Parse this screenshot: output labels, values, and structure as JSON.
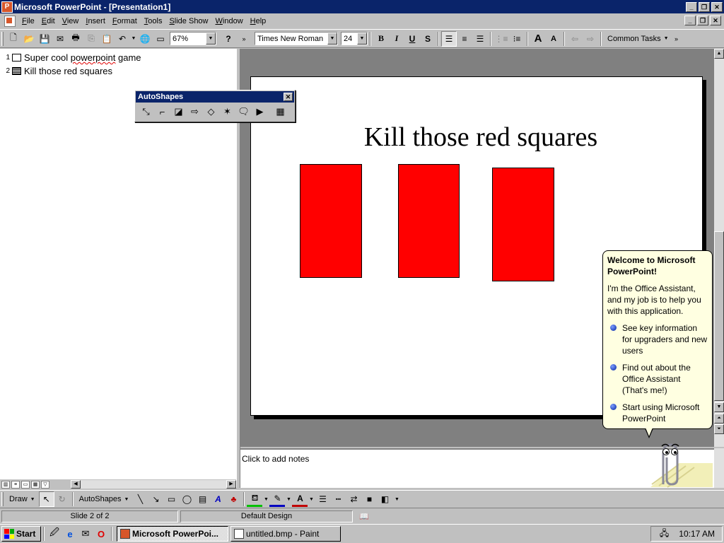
{
  "window": {
    "title": "Microsoft PowerPoint - [Presentation1]"
  },
  "menu": {
    "items": [
      "File",
      "Edit",
      "View",
      "Insert",
      "Format",
      "Tools",
      "Slide Show",
      "Window",
      "Help"
    ]
  },
  "toolbar": {
    "zoom": "67%",
    "font": "Times New Roman",
    "font_size": "24",
    "common_tasks": "Common Tasks"
  },
  "outline": {
    "slides": [
      {
        "number": "1",
        "title": "Super cool powerpoint game"
      },
      {
        "number": "2",
        "title": "Kill those red squares"
      }
    ]
  },
  "autoshapes_toolbar": {
    "title": "AutoShapes"
  },
  "slide": {
    "title": "Kill those red squares",
    "square_color": "#ff0000"
  },
  "notes": {
    "placeholder": "Click to add notes"
  },
  "drawing_toolbar": {
    "draw": "Draw",
    "autoshapes": "AutoShapes"
  },
  "status": {
    "slide": "Slide 2 of 2",
    "design": "Default Design"
  },
  "assistant": {
    "title": "Welcome to Microsoft PowerPoint!",
    "body": "I'm the Office Assistant, and my job is to help you with this application.",
    "options": [
      "See key information for upgraders and new users",
      "Find out about the Office Assistant (That's me!)",
      "Start using Microsoft PowerPoint"
    ]
  },
  "taskbar": {
    "start": "Start",
    "tasks": [
      "Microsoft PowerPoi...",
      "untitled.bmp - Paint"
    ],
    "clock": "10:17 AM"
  }
}
